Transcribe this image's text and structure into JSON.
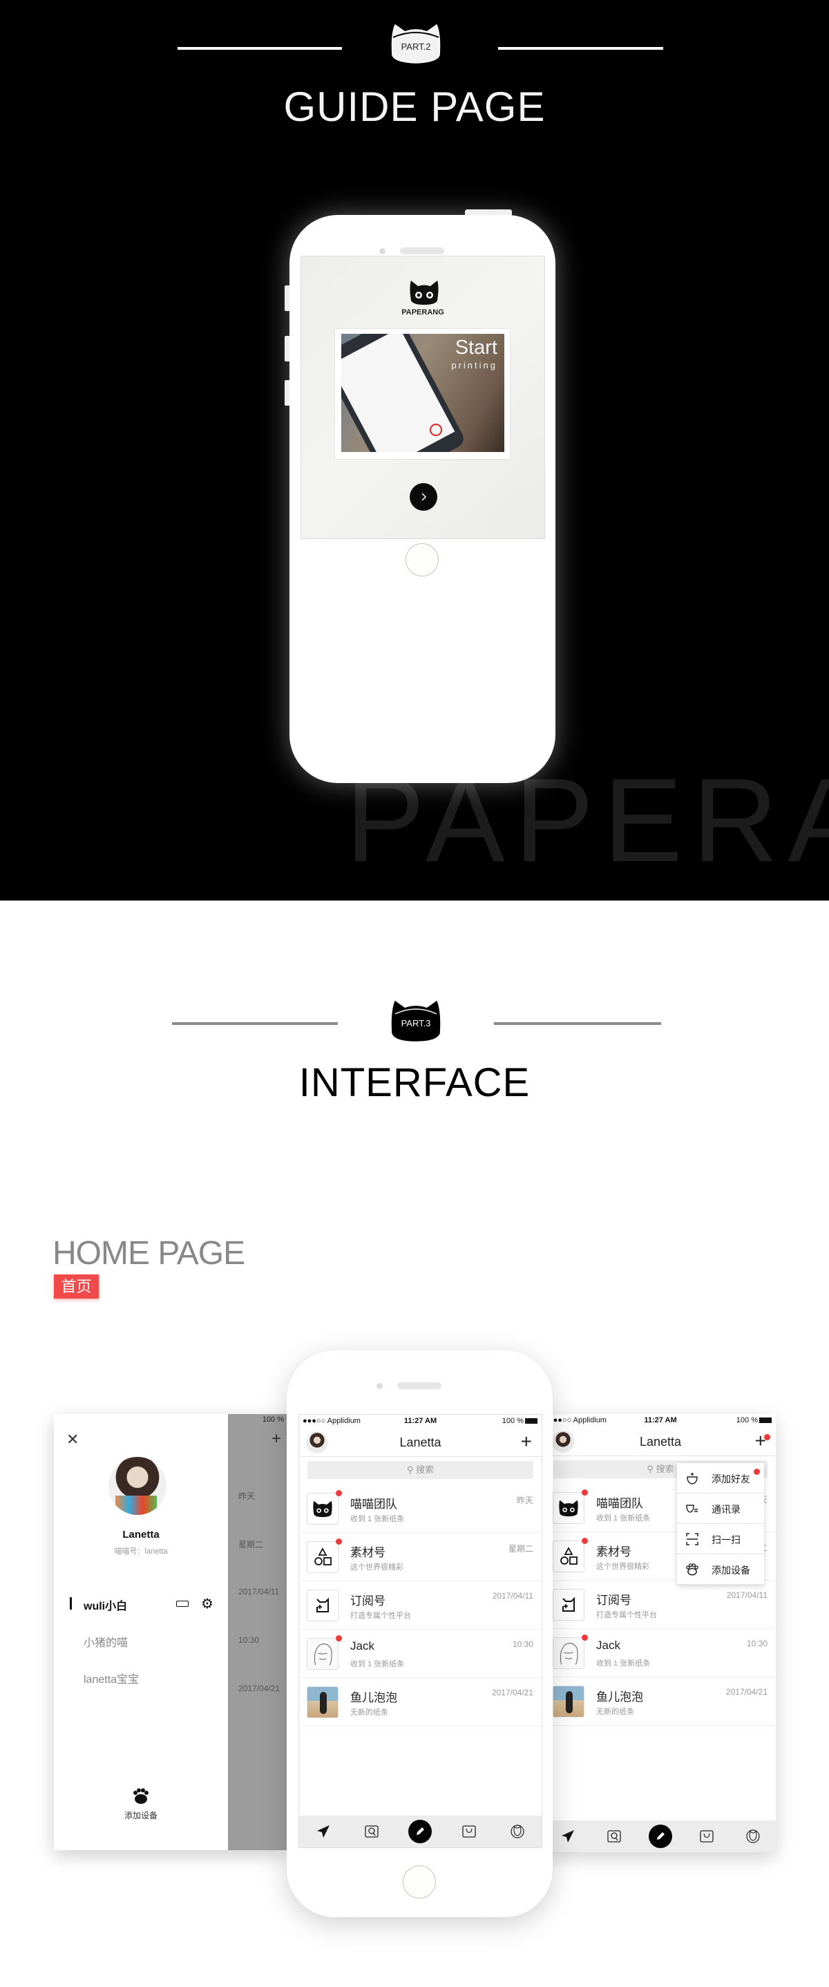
{
  "part2": {
    "badge": "PART.2",
    "title": "GUIDE PAGE",
    "watermark": "PAPERANG",
    "guide_screen": {
      "logo_text": "PAPERANG",
      "photo_title": "Start",
      "photo_subtitle": "printing",
      "next_icon": "chevron-right-icon"
    }
  },
  "part3": {
    "badge": "PART.3",
    "title": "INTERFACE",
    "section_title": "HOME PAGE",
    "section_tag": "首页",
    "tag_color": "#f04a4a"
  },
  "status_bar": {
    "carrier": "●●●○○ Applidium",
    "time": "11:27 AM",
    "battery": "100 %"
  },
  "home": {
    "title": "Lanetta",
    "search_placeholder": "搜索",
    "rows": [
      {
        "title": "喵喵团队",
        "subtitle": "收到 1 张新纸条",
        "time": "昨天",
        "icon": "cat-logo-icon",
        "unread": true
      },
      {
        "title": "素材号",
        "subtitle": "这个世界很精彩",
        "time": "星期二",
        "icon": "shapes-icon",
        "unread": true
      },
      {
        "title": "订阅号",
        "subtitle": "打造专属个性平台",
        "time": "2017/04/11",
        "icon": "subscribe-icon",
        "unread": false
      },
      {
        "title": "Jack",
        "subtitle": "收到 1 张新纸条",
        "time": "10:30",
        "icon": "sketch-avatar",
        "unread": true
      },
      {
        "title": "鱼儿泡泡",
        "subtitle": "无新的纸条",
        "time": "2017/04/21",
        "icon": "photo-avatar",
        "unread": false
      }
    ],
    "tabs": [
      "paper-plane-icon",
      "search-doc-icon",
      "pencil-icon",
      "cat-box-icon",
      "cat-face-icon"
    ]
  },
  "drawer": {
    "name": "Lanetta",
    "id_line": "喵喵号：lanetta",
    "devices": [
      {
        "label": "wuli小白",
        "active": true
      },
      {
        "label": "小猪的喵",
        "active": false
      },
      {
        "label": "lanetta宝宝",
        "active": false
      }
    ],
    "add_device": "添加设备",
    "behind_times": [
      "昨天",
      "星期二",
      "2017/04/11",
      "10:30",
      "2017/04/21"
    ],
    "behind_battery": "100 %"
  },
  "plus_menu": {
    "items": [
      {
        "label": "添加好友",
        "icon": "add-friend-icon",
        "badge": true
      },
      {
        "label": "通讯录",
        "icon": "contacts-icon",
        "badge": false
      },
      {
        "label": "扫一扫",
        "icon": "scan-icon",
        "badge": false
      },
      {
        "label": "添加设备",
        "icon": "paw-icon",
        "badge": false
      }
    ]
  },
  "colors": {
    "unread_dot": "#f03a3a",
    "tab_bar": "#ececec"
  }
}
